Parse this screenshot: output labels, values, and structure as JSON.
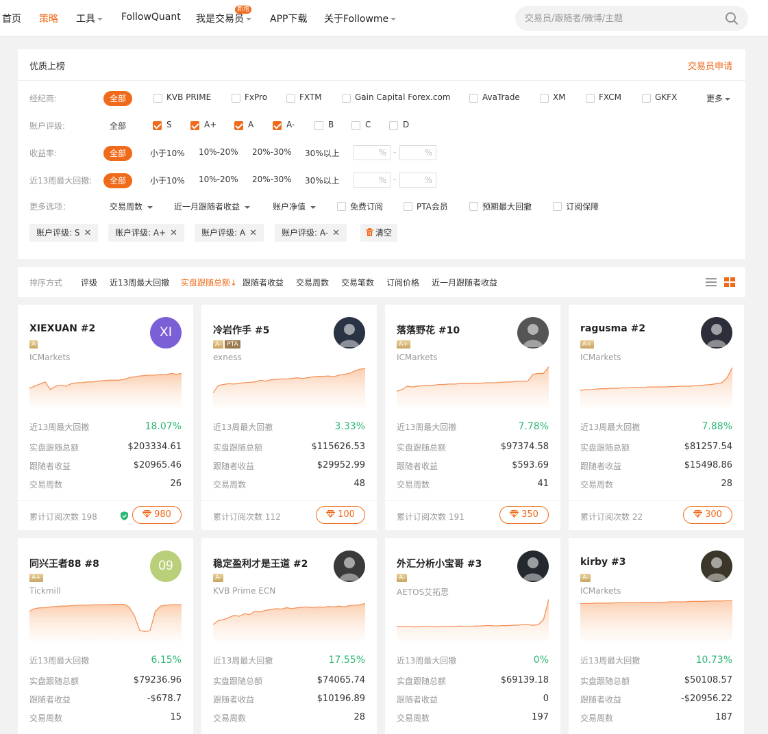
{
  "nav": {
    "items": [
      "首页",
      "策略",
      "工具",
      "FollowQuant",
      "我是交易员",
      "APP下载",
      "关于Followme"
    ],
    "new_badge": "新增",
    "search_placeholder": "交易员/跟随者/微博/主题"
  },
  "panel": {
    "title": "优质上榜",
    "apply": "交易员申请",
    "broker_label": "经纪商:",
    "all": "全部",
    "brokers": [
      "KVB PRIME",
      "FxPro",
      "FXTM",
      "Gain Capital Forex.com",
      "AvaTrade",
      "XM",
      "FXCM",
      "GKFX"
    ],
    "more": "更多",
    "rating_label": "账户评级:",
    "ratings": [
      "S",
      "A+",
      "A",
      "A-",
      "B",
      "C",
      "D"
    ],
    "ratings_checked": [
      true,
      true,
      true,
      true,
      false,
      false,
      false
    ],
    "return_label": "收益率:",
    "drawdown_label": "近13周最大回撤:",
    "ranges": [
      "小于10%",
      "10%-20%",
      "20%-30%",
      "30%以上"
    ],
    "percent": "%",
    "dash": "-",
    "more_label": "更多选项：",
    "more_dropdowns": [
      "交易周数",
      "近一月跟随者收益",
      "账户净值"
    ],
    "more_checks": [
      "免费订阅",
      "PTA会员",
      "预期最大回撤",
      "订阅保障"
    ],
    "tags": [
      "账户评级:  S",
      "账户评级:  A+",
      "账户评级:  A",
      "账户评级:  A-"
    ],
    "tag_close": "✕",
    "clear": "清空"
  },
  "sort": {
    "label": "排序方式",
    "items": [
      "评级",
      "近13周最大回撤",
      "实盘跟随总额",
      "跟随者收益",
      "交易周数",
      "交易笔数",
      "订阅价格",
      "近一月跟随者收益"
    ],
    "active_arrow": "↓"
  },
  "card_labels": {
    "drawdown": "近13周最大回撤",
    "total": "实盘跟随总额",
    "follower_profit": "跟随者收益",
    "weeks": "交易周数",
    "subs_prefix": "累计订阅次数"
  },
  "cards": [
    {
      "name": "XIEXUAN #2",
      "level": "A",
      "pta": "",
      "broker": "ICMarkets",
      "avatar_text": "XI",
      "avatar_color": "#7b5fd6",
      "drawdown": "18.07%",
      "total": "$203334.61",
      "profit": "$20965.46",
      "weeks": "26",
      "subs": "198",
      "price": "980",
      "protected": true,
      "curve": [
        0.55,
        0.5,
        0.45,
        0.4,
        0.58,
        0.5,
        0.48,
        0.5,
        0.44,
        0.42,
        0.42,
        0.4,
        0.4,
        0.38,
        0.37,
        0.36,
        0.36,
        0.36,
        0.34,
        0.3,
        0.28,
        0.26,
        0.25,
        0.24,
        0.24,
        0.22,
        0.23,
        0.2,
        0.22,
        0.2
      ]
    },
    {
      "name": "冷岩作手 #5",
      "level": "A-",
      "pta": "PTA",
      "broker": "exness",
      "avatar_text": "",
      "avatar_color": "#2a3344",
      "drawdown": "3.33%",
      "total": "$115626.53",
      "profit": "$29952.99",
      "weeks": "48",
      "subs": "112",
      "price": "100",
      "protected": false,
      "curve": [
        0.66,
        0.48,
        0.46,
        0.44,
        0.45,
        0.43,
        0.42,
        0.41,
        0.4,
        0.36,
        0.38,
        0.35,
        0.34,
        0.33,
        0.33,
        0.32,
        0.3,
        0.32,
        0.3,
        0.28,
        0.27,
        0.27,
        0.26,
        0.28,
        0.24,
        0.22,
        0.2,
        0.14,
        0.1,
        0.08
      ]
    },
    {
      "name": "落落野花 #10",
      "level": "A+",
      "pta": "",
      "broker": "ICMarkets",
      "avatar_text": "",
      "avatar_color": "#555555",
      "drawdown": "7.78%",
      "total": "$97374.58",
      "profit": "$593.69",
      "weeks": "41",
      "subs": "191",
      "price": "350",
      "protected": false,
      "curve": [
        0.62,
        0.58,
        0.5,
        0.52,
        0.5,
        0.49,
        0.48,
        0.48,
        0.46,
        0.46,
        0.45,
        0.45,
        0.44,
        0.44,
        0.44,
        0.43,
        0.43,
        0.42,
        0.42,
        0.42,
        0.41,
        0.4,
        0.4,
        0.38,
        0.38,
        0.38,
        0.22,
        0.2,
        0.2,
        0.04
      ]
    },
    {
      "name": "ragusma #2",
      "level": "A+",
      "pta": "",
      "broker": "ICMarkets",
      "avatar_text": "",
      "avatar_color": "#2c2f3a",
      "drawdown": "7.88%",
      "total": "$81257.54",
      "profit": "$15498.86",
      "weeks": "28",
      "subs": "22",
      "price": "300",
      "protected": false,
      "curve": [
        0.6,
        0.58,
        0.58,
        0.57,
        0.56,
        0.56,
        0.55,
        0.55,
        0.54,
        0.54,
        0.53,
        0.53,
        0.53,
        0.52,
        0.52,
        0.52,
        0.52,
        0.51,
        0.51,
        0.5,
        0.5,
        0.5,
        0.49,
        0.48,
        0.47,
        0.46,
        0.44,
        0.42,
        0.3,
        0.06
      ]
    },
    {
      "name": "同兴王者88 #8",
      "level": "A+",
      "pta": "",
      "broker": "Tickmill",
      "avatar_text": "09",
      "avatar_color": "#b9cf7a",
      "drawdown": "6.15%",
      "total": "$79236.96",
      "profit": "-$678.7",
      "weeks": "15",
      "subs": "",
      "price": "",
      "protected": false,
      "curve": [
        0.3,
        0.24,
        0.22,
        0.22,
        0.2,
        0.19,
        0.18,
        0.18,
        0.17,
        0.16,
        0.16,
        0.16,
        0.15,
        0.15,
        0.15,
        0.15,
        0.14,
        0.14,
        0.14,
        0.2,
        0.4,
        0.75,
        0.78,
        0.76,
        0.3,
        0.18,
        0.16,
        0.15,
        0.15,
        0.15
      ]
    },
    {
      "name": "稳定盈利才是王道 #2",
      "level": "A-",
      "pta": "",
      "broker": "KVB Prime ECN",
      "avatar_text": "",
      "avatar_color": "#3a3a3a",
      "drawdown": "17.55%",
      "total": "$74065.74",
      "profit": "$10196.89",
      "weeks": "28",
      "subs": "",
      "price": "",
      "protected": false,
      "curve": [
        0.62,
        0.52,
        0.5,
        0.45,
        0.4,
        0.42,
        0.36,
        0.38,
        0.3,
        0.32,
        0.28,
        0.26,
        0.24,
        0.25,
        0.22,
        0.24,
        0.22,
        0.21,
        0.2,
        0.22,
        0.2,
        0.21,
        0.19,
        0.2,
        0.18,
        0.2,
        0.17,
        0.16,
        0.15,
        0.12
      ]
    },
    {
      "name": "外汇分析小宝哥 #3",
      "level": "A-",
      "pta": "",
      "broker": "AETOS艾拓思",
      "avatar_text": "",
      "avatar_color": "#23292f",
      "drawdown": "0%",
      "total": "$69139.18",
      "profit": "0",
      "weeks": "197",
      "subs": "",
      "price": "",
      "protected": false,
      "curve": [
        0.66,
        0.67,
        0.66,
        0.67,
        0.67,
        0.66,
        0.66,
        0.67,
        0.67,
        0.66,
        0.66,
        0.66,
        0.65,
        0.66,
        0.66,
        0.65,
        0.65,
        0.64,
        0.64,
        0.65,
        0.64,
        0.64,
        0.63,
        0.63,
        0.62,
        0.62,
        0.63,
        0.62,
        0.5,
        0.02
      ]
    },
    {
      "name": "kirby #3",
      "level": "A-",
      "pta": "",
      "broker": "ICMarkets",
      "avatar_text": "",
      "avatar_color": "#3b362a",
      "drawdown": "10.73%",
      "total": "$50108.57",
      "profit": "-$20956.22",
      "weeks": "187",
      "subs": "",
      "price": "",
      "protected": false,
      "curve": [
        0.12,
        0.12,
        0.12,
        0.11,
        0.11,
        0.11,
        0.11,
        0.1,
        0.1,
        0.1,
        0.1,
        0.1,
        0.09,
        0.09,
        0.09,
        0.09,
        0.09,
        0.08,
        0.08,
        0.08,
        0.08,
        0.07,
        0.07,
        0.07,
        0.07,
        0.06,
        0.06,
        0.06,
        0.05,
        0.05
      ]
    }
  ]
}
